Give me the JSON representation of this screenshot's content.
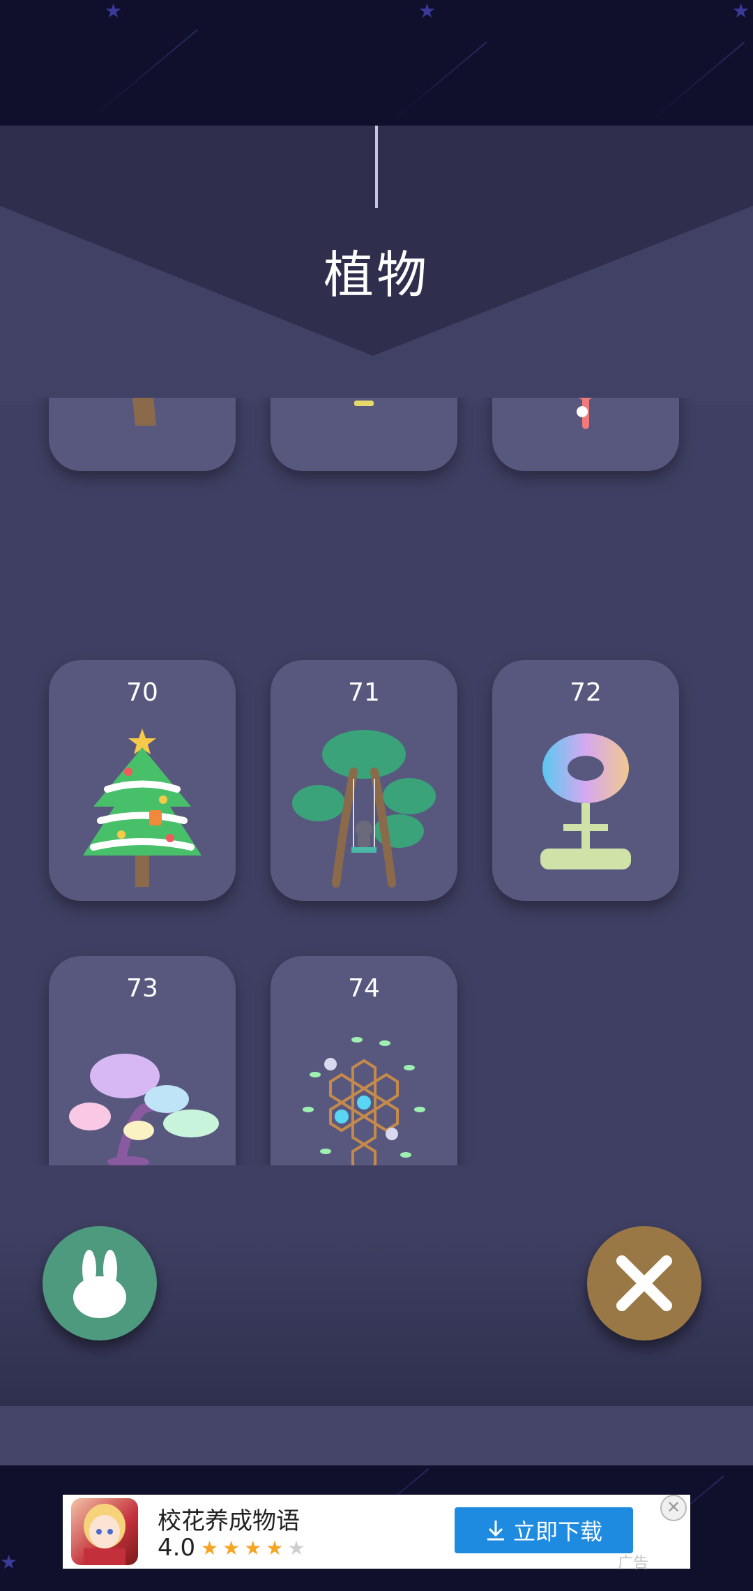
{
  "header": {
    "title": "植物"
  },
  "cards": [
    {
      "number": "",
      "icon": "tree-with-lights-icon"
    },
    {
      "number": "",
      "icon": "palm-plant-icon"
    },
    {
      "number": "",
      "icon": "coral-icon"
    },
    {
      "number": "70",
      "icon": "christmas-tree-icon"
    },
    {
      "number": "71",
      "icon": "swing-tree-icon"
    },
    {
      "number": "72",
      "icon": "pixel-flower-icon"
    },
    {
      "number": "73",
      "icon": "cloud-bonsai-icon"
    },
    {
      "number": "74",
      "icon": "honeycomb-tree-icon"
    }
  ],
  "buttons": {
    "left_icon": "rabbit-icon",
    "right_icon": "close-icon"
  },
  "ad": {
    "app_name": "校花养成物语",
    "rating": "4.0",
    "stars_filled": 4,
    "stars_total": 5,
    "download_label": "立即下载",
    "ad_label": "广告",
    "close_symbol": "✕"
  },
  "colors": {
    "panel": "#3f3f63",
    "card": "#58587f",
    "left_button": "#4e9a7f",
    "right_button": "#9a7846",
    "download_button": "#1f8be0"
  }
}
